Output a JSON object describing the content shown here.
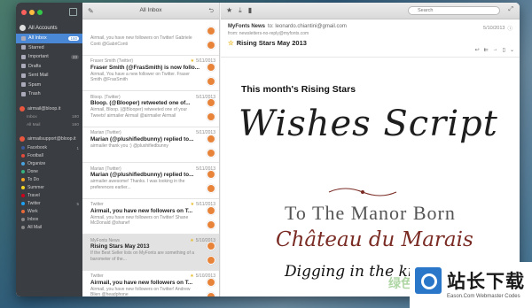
{
  "sidebar": {
    "all_accounts": "All Accounts",
    "folders": [
      {
        "label": "All Inbox",
        "count": "160",
        "active": true
      },
      {
        "label": "Starred",
        "count": ""
      },
      {
        "label": "Important",
        "count": "23"
      },
      {
        "label": "Drafts",
        "count": ""
      },
      {
        "label": "Sent Mail",
        "count": ""
      },
      {
        "label": "Spam",
        "count": ""
      },
      {
        "label": "Trash",
        "count": ""
      }
    ],
    "account1": {
      "email": "airmail@bloop.it",
      "subs": [
        {
          "label": "Inbox",
          "count": "180"
        },
        {
          "label": "All Mail",
          "count": "160"
        }
      ]
    },
    "account2": {
      "email": "airmailsupport@bloop.it",
      "tags": [
        {
          "label": "Facebook",
          "count": "1",
          "color": "#3b5998"
        },
        {
          "label": "Football",
          "count": "",
          "color": "#e24b3b"
        },
        {
          "label": "Organize",
          "count": "",
          "color": "#4aa3df"
        },
        {
          "label": "Done",
          "count": "",
          "color": "#36b37e"
        },
        {
          "label": "To Do",
          "count": "",
          "color": "#f5a623"
        },
        {
          "label": "Summer",
          "count": "",
          "color": "#f5d423"
        },
        {
          "label": "Travel",
          "count": "",
          "color": "#d0021b"
        },
        {
          "label": "Twitter",
          "count": "5",
          "color": "#1da1f2"
        },
        {
          "label": "Work",
          "count": "",
          "color": "#e86a3a"
        },
        {
          "label": "Inbox",
          "count": "",
          "color": "#888888"
        },
        {
          "label": "All Mail",
          "count": "",
          "color": "#888888"
        }
      ]
    }
  },
  "list": {
    "title": "All Inbox",
    "messages": [
      {
        "from": "",
        "date": "",
        "subject": "",
        "preview": "Airmail, you have new followers on Twitter!   Gabriele Conti @GabriConti",
        "star": false
      },
      {
        "from": "Fraser Smith (Twitter)",
        "date": "5/11/2013",
        "subject": "Fraser Smith (@FrasSmith) is now follo...",
        "preview": "Airmail, You have a new follower on Twitter.   Fraser Smith @FrasSmith",
        "star": true
      },
      {
        "from": "Bloop. (Twitter)",
        "date": "5/11/2013",
        "subject": "Bloop. (@Blooper) retweeted one of...",
        "preview": "Airmail, Bloop. (@Blooper) retweeted one of your Tweets!   airmailer Airmail @airmailer Airmail",
        "star": false
      },
      {
        "from": "Marian (Twitter)",
        "date": "5/11/2013",
        "subject": "Marian (@plushifiedbunny) replied to...",
        "preview": "airmailer thank you :) @plushifiedbunny",
        "star": false
      },
      {
        "from": "Marian (Twitter)",
        "date": "5/11/2013",
        "subject": "Marian (@plushifiedbunny) replied to...",
        "preview": "airmailer awesome! Thanks. I was looking in the preferences earlier...",
        "star": false
      },
      {
        "from": "Twitter",
        "date": "5/11/2013",
        "subject": "Airmail, you have new followers on T...",
        "preview": "Airmail, you have new followers on Twitter!   Shane McDonald @shanef",
        "star": true
      },
      {
        "from": "MyFonts News",
        "date": "5/10/2013",
        "subject": "Rising Stars May 2013",
        "preview": "If the Best Seller lists on MyFonts are something of a barometer of the...",
        "star": true,
        "selected": true
      },
      {
        "from": "Twitter",
        "date": "5/10/2013",
        "subject": "Airmail, you have new followers on T...",
        "preview": "Airmail, you have new followers on Twitter!   Andrew Blien @headphone",
        "star": true
      }
    ]
  },
  "reader": {
    "search_placeholder": "Search",
    "from_name": "MyFonts News",
    "to": "to: leonardo.chiantini@gmail.com",
    "from_addr": "from: newsletters-no-reply@myfonts.com",
    "date": "5/10/2013",
    "subject": "Rising Stars May 2013",
    "body": {
      "headline": "This month's Rising Stars",
      "font1": "Wishes Script",
      "font2": "To The Manor Born",
      "font3": "Château du Marais",
      "font4": "Digging in the kitch"
    }
  },
  "watermark": {
    "cn_text": "绿色资源网",
    "brand": "站长下载",
    "url": "Eason.Com Webmaster Codes"
  }
}
